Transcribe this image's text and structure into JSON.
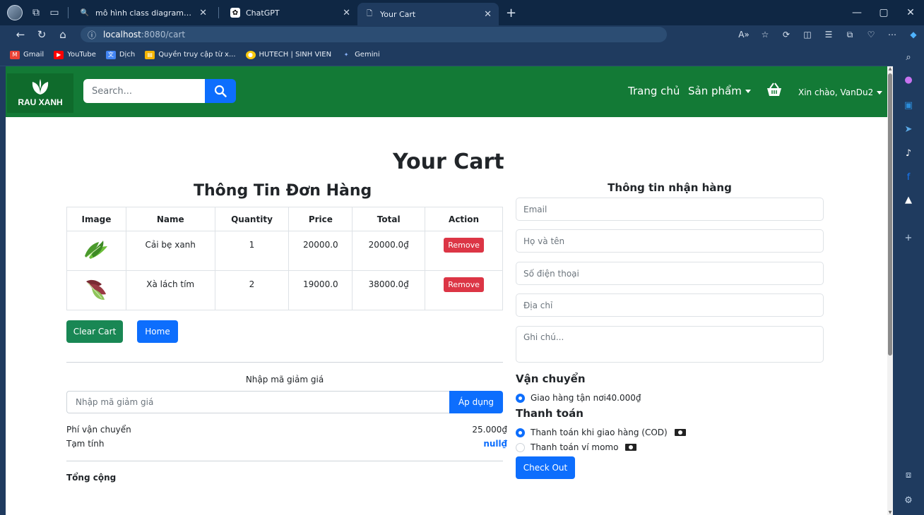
{
  "browser": {
    "tabs": [
      {
        "title": "mô hình class diagram online - T",
        "active": false
      },
      {
        "title": "ChatGPT",
        "active": false
      },
      {
        "title": "Your Cart",
        "active": true
      }
    ],
    "url_host": "localhost",
    "url_path": ":8080/cart",
    "bookmarks": [
      "Gmail",
      "YouTube",
      "Dịch",
      "Quyền truy cập từ x...",
      "HUTECH | SINH VIEN",
      "Gemini"
    ]
  },
  "navbar": {
    "logo_text": "RAU XANH",
    "search_placeholder": "Search...",
    "home_label": "Trang chủ",
    "products_label": "Sản phẩm",
    "greeting": "Xin chào, VanDu2"
  },
  "page": {
    "title": "Your Cart",
    "order_title": "Thông Tin Đơn Hàng"
  },
  "cart": {
    "headers": [
      "Image",
      "Name",
      "Quantity",
      "Price",
      "Total",
      "Action"
    ],
    "rows": [
      {
        "name": "Cải bẹ xanh",
        "quantity": "1",
        "price": "20000.0",
        "total": "20000.0₫",
        "action": "Remove"
      },
      {
        "name": "Xà lách tím",
        "quantity": "2",
        "price": "19000.0",
        "total": "38000.0₫",
        "action": "Remove"
      }
    ],
    "clear_label": "Clear Cart",
    "home_label": "Home"
  },
  "coupon": {
    "label": "Nhập mã giảm giá",
    "placeholder": "Nhập mã giảm giá",
    "apply_label": "Áp dụng"
  },
  "summary": {
    "shipping_label": "Phí vận chuyển",
    "shipping_value": "25.000₫",
    "subtotal_label": "Tạm tính",
    "subtotal_value": "null₫",
    "total_label": "Tổng cộng"
  },
  "receiver": {
    "title": "Thông tin nhận hàng",
    "email_placeholder": "Email",
    "name_placeholder": "Họ và tên",
    "phone_placeholder": "Số điện thoại",
    "address_placeholder": "Địa chỉ",
    "note_placeholder": "Ghi chú...",
    "shipping_heading": "Vận chuyển",
    "shipping_option": "Giao hàng tận nơi40.000₫",
    "payment_heading": "Thanh toán",
    "payment_cod": "Thanh toán khi giao hàng (COD)",
    "payment_momo": "Thanh toán ví momo",
    "checkout_label": "Check Out"
  },
  "colors": {
    "navbar_green": "#137a36",
    "primary_blue": "#0d6efd",
    "danger_red": "#dc3545",
    "success_green": "#198754"
  }
}
